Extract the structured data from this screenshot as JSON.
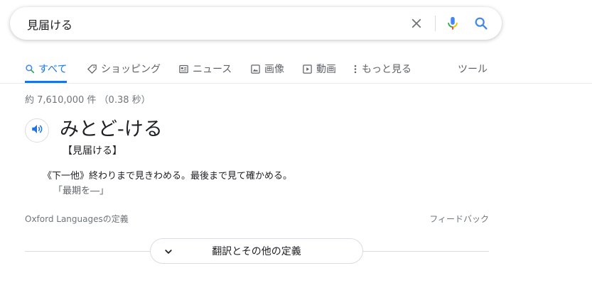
{
  "search": {
    "query": "見届ける"
  },
  "tabs": [
    {
      "label": "すべて",
      "icon": "search-icon",
      "active": true
    },
    {
      "label": "ショッピング",
      "icon": "tag-icon",
      "active": false
    },
    {
      "label": "ニュース",
      "icon": "newspaper-icon",
      "active": false
    },
    {
      "label": "画像",
      "icon": "image-icon",
      "active": false
    },
    {
      "label": "動画",
      "icon": "play-icon",
      "active": false
    },
    {
      "label": "もっと見る",
      "icon": "more-vert-icon",
      "active": false
    }
  ],
  "tools_label": "ツール",
  "result_stats": "約 7,610,000 件 （0.38 秒）",
  "dictionary": {
    "headword": "みとど-ける",
    "kanji": "【見届ける】",
    "definition": "《下一他》終わりまで見きわめる。最後まで見て確かめる。",
    "example": "「最期を―」",
    "source": "Oxford Languagesの定義",
    "feedback": "フィードバック",
    "more_label": "翻訳とその他の定義"
  },
  "colors": {
    "accent": "#1a73e8",
    "mic_blue": "#4285f4",
    "mic_red": "#ea4335",
    "mic_yellow": "#fbbc04",
    "mic_green": "#34a853"
  }
}
